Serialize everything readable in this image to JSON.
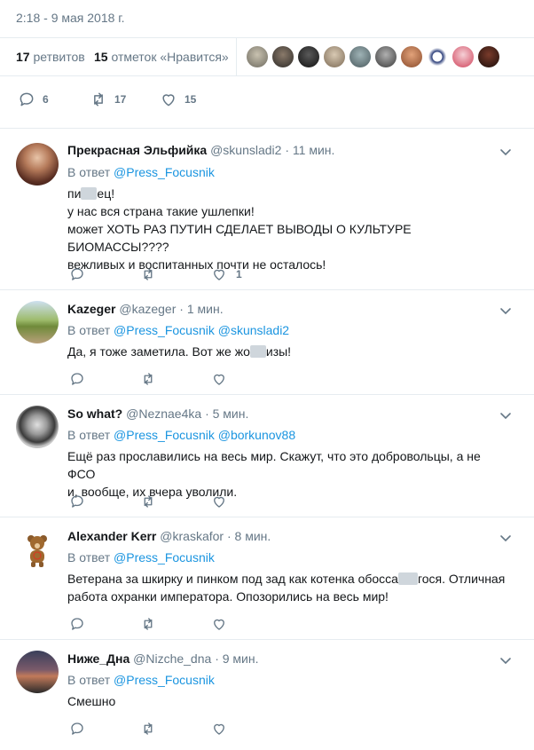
{
  "timestamp": "2:18 - 9 мая 2018 г.",
  "stats": {
    "retweets_count": "17",
    "retweets_label": "ретвитов",
    "likes_count": "15",
    "likes_label": "отметок «Нравится»"
  },
  "main_actions": {
    "replies": "6",
    "retweets": "17",
    "likes": "15"
  },
  "tweets": [
    {
      "name": "Прекрасная Эльфийка",
      "handle": "@skunsladi2",
      "time": "11 мин.",
      "reply_prefix": "В ответ",
      "reply_to": [
        "@Press_Focusnik"
      ],
      "lines": [
        "пи",
        "ец!",
        "у нас вся страна такие ушлепки!",
        "может ХОТЬ РАЗ ПУТИН СДЕЛАЕТ ВЫВОДЫ О КУЛЬТУРЕ БИОМАССЫ????",
        "вежливых и воспитанных почти не осталось!"
      ],
      "likes": "1"
    },
    {
      "name": "Kazeger",
      "handle": "@kazeger",
      "time": "1 мин.",
      "reply_prefix": "В ответ",
      "reply_to": [
        "@Press_Focusnik",
        "@skunsladi2"
      ],
      "lines": [
        "Да, я тоже заметила. Вот же жо",
        "изы!"
      ]
    },
    {
      "name": "So what?",
      "handle": "@Neznae4ka",
      "time": "5 мин.",
      "reply_prefix": "В ответ",
      "reply_to": [
        "@Press_Focusnik",
        "@borkunov88"
      ],
      "lines": [
        "Ещё раз прославились на весь мир. Скажут, что это добровольцы, а не ФСО",
        "и, вообще, их вчера уволили."
      ]
    },
    {
      "name": "Alexander Kerr",
      "handle": "@kraskafor",
      "time": "8 мин.",
      "reply_prefix": "В ответ",
      "reply_to": [
        "@Press_Focusnik"
      ],
      "lines": [
        "Ветерана за шкирку и пинком под зад как котенка обосса",
        "гося. Отличная",
        "работа охранки императора. Опозорились на весь мир!"
      ]
    },
    {
      "name": "Ниже_Дна",
      "handle": "@Nizche_dna",
      "time": "9 мин.",
      "reply_prefix": "В ответ",
      "reply_to": [
        "@Press_Focusnik"
      ],
      "lines": [
        "Смешно"
      ]
    }
  ],
  "colors": {
    "link": "#1b95e0",
    "secondary": "#657786",
    "border": "#e6ecf0"
  }
}
